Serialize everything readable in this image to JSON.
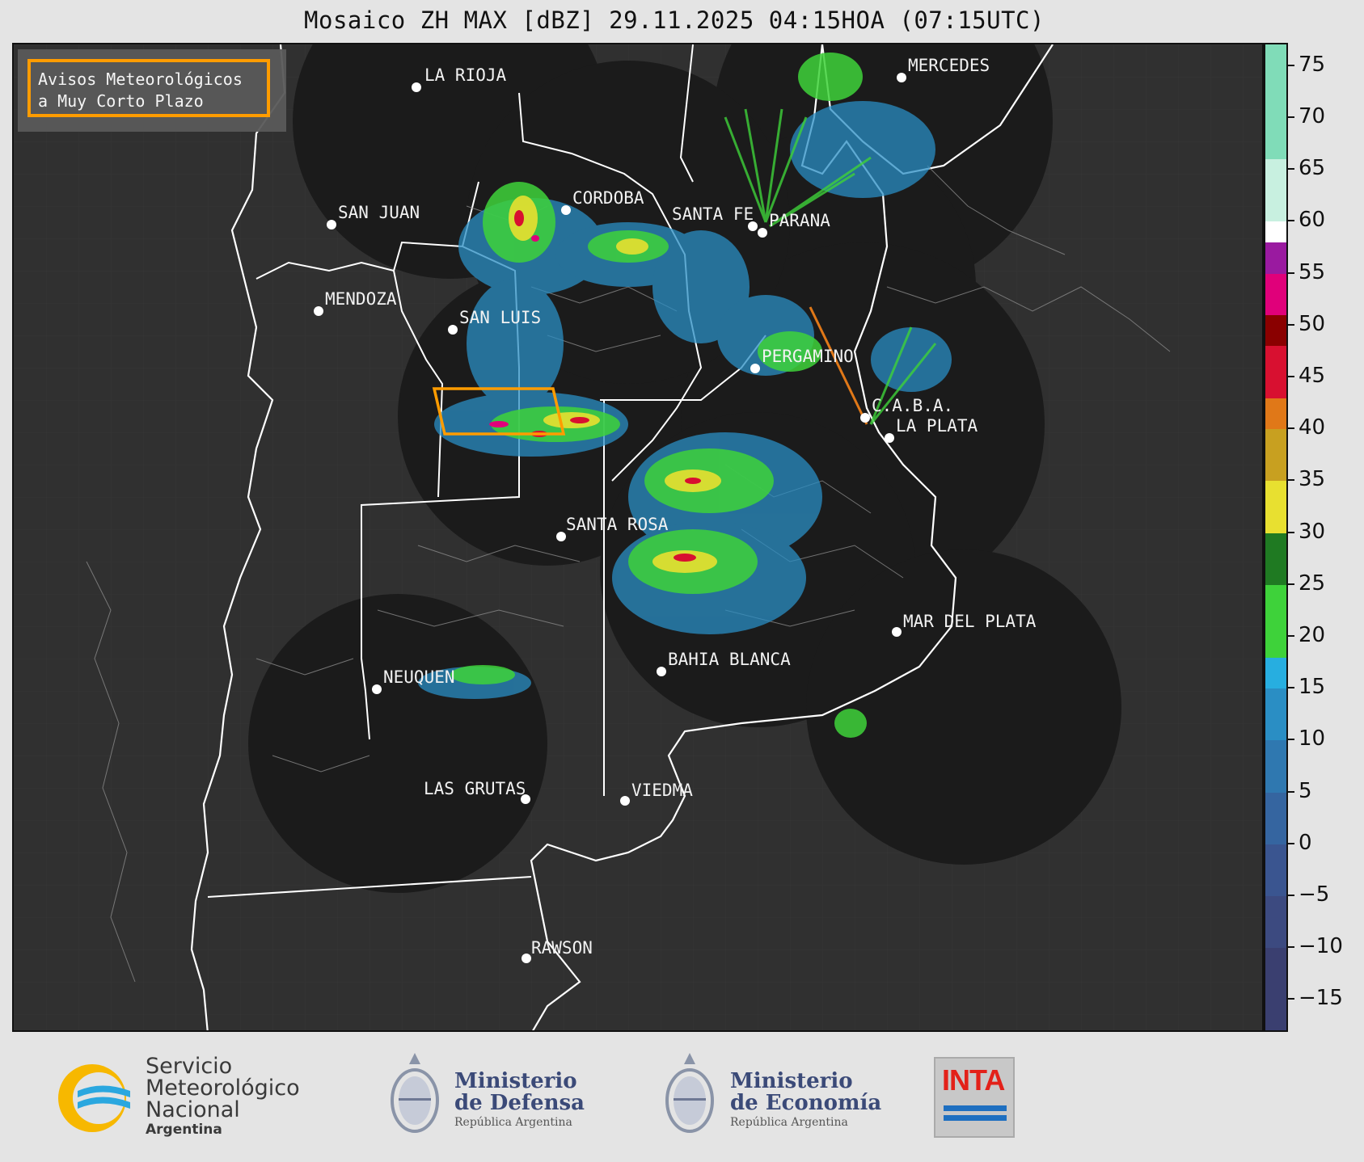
{
  "title": "Mosaico ZH MAX [dBZ] 29.11.2025 04:15HOA (07:15UTC)",
  "legend": {
    "line1": "Avisos Meteorológicos",
    "line2": "a Muy Corto Plazo",
    "border_color": "#ff9c00"
  },
  "cities": [
    {
      "name": "LA RIOJA"
    },
    {
      "name": "MERCEDES"
    },
    {
      "name": "CORDOBA"
    },
    {
      "name": "SAN JUAN"
    },
    {
      "name": "SANTA FE"
    },
    {
      "name": "PARANA"
    },
    {
      "name": "MENDOZA"
    },
    {
      "name": "SAN LUIS"
    },
    {
      "name": "PERGAMINO"
    },
    {
      "name": "C.A.B.A."
    },
    {
      "name": "LA PLATA"
    },
    {
      "name": "SANTA ROSA"
    },
    {
      "name": "MAR DEL PLATA"
    },
    {
      "name": "BAHIA BLANCA"
    },
    {
      "name": "NEUQUEN"
    },
    {
      "name": "LAS GRUTAS"
    },
    {
      "name": "VIEDMA"
    },
    {
      "name": "RAWSON"
    }
  ],
  "colorbar": {
    "unit": "dBZ",
    "min": -18,
    "max": 77,
    "ticks": [
      "75",
      "70",
      "65",
      "60",
      "55",
      "50",
      "45",
      "40",
      "35",
      "30",
      "25",
      "20",
      "15",
      "10",
      "5",
      "0",
      "−5",
      "−10",
      "−15"
    ],
    "tick_values": [
      75,
      70,
      65,
      60,
      55,
      50,
      45,
      40,
      35,
      30,
      25,
      20,
      15,
      10,
      5,
      0,
      -5,
      -10,
      -15
    ],
    "bands": [
      {
        "from": -18,
        "to": -10,
        "color": "#3a3f70"
      },
      {
        "from": -10,
        "to": -5,
        "color": "#3c4a80"
      },
      {
        "from": -5,
        "to": 0,
        "color": "#3a5590"
      },
      {
        "from": 0,
        "to": 5,
        "color": "#3565a0"
      },
      {
        "from": 5,
        "to": 10,
        "color": "#2f78b0"
      },
      {
        "from": 10,
        "to": 15,
        "color": "#2a8ec4"
      },
      {
        "from": 15,
        "to": 18,
        "color": "#27aee0"
      },
      {
        "from": 18,
        "to": 25,
        "color": "#3ed23a"
      },
      {
        "from": 25,
        "to": 30,
        "color": "#1f7a22"
      },
      {
        "from": 30,
        "to": 35,
        "color": "#e8e030"
      },
      {
        "from": 35,
        "to": 40,
        "color": "#c8a020"
      },
      {
        "from": 40,
        "to": 43,
        "color": "#e07818"
      },
      {
        "from": 43,
        "to": 48,
        "color": "#d81030"
      },
      {
        "from": 48,
        "to": 51,
        "color": "#8a0000"
      },
      {
        "from": 51,
        "to": 55,
        "color": "#e0007a"
      },
      {
        "from": 55,
        "to": 58,
        "color": "#9a1aa0"
      },
      {
        "from": 58,
        "to": 60,
        "color": "#ffffff"
      },
      {
        "from": 60,
        "to": 66,
        "color": "#c8f0e0"
      },
      {
        "from": 66,
        "to": 77,
        "color": "#80dcb8"
      }
    ]
  },
  "footer": {
    "smn": {
      "line1": "Servicio",
      "line2": "Meteorológico",
      "line3": "Nacional",
      "sub": "Argentina"
    },
    "defensa": {
      "line1": "Ministerio",
      "line2": "de Defensa",
      "sub": "República Argentina"
    },
    "economia": {
      "line1": "Ministerio",
      "line2": "de Economía",
      "sub": "República Argentina"
    },
    "inta": {
      "label": "INTA"
    }
  }
}
